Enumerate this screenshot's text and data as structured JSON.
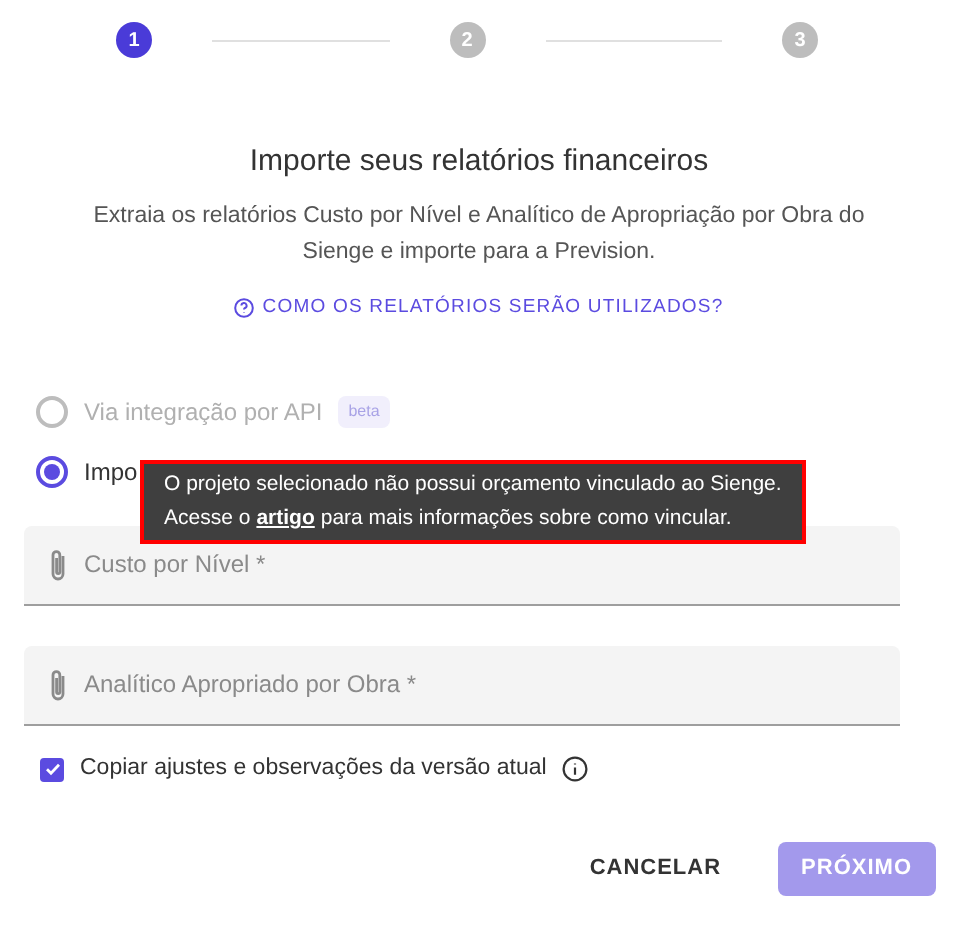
{
  "steps": [
    {
      "label": "1",
      "selected": true
    },
    {
      "label": "2",
      "selected": false
    },
    {
      "label": "3",
      "selected": false
    }
  ],
  "title": "Importe seus relatórios financeiros",
  "description": "Extraia os relatórios Custo por Nível e Analítico de Apropriação por Obra do Sienge e importe para a Prevision.",
  "help_link": "COMO OS RELATÓRIOS SERÃO UTILIZADOS?",
  "options": [
    {
      "label": "Via integração por API",
      "badge": "beta",
      "selected": false,
      "disabled": true
    },
    {
      "label": "Impo",
      "selected": true,
      "disabled": false
    }
  ],
  "tooltip": {
    "line_1": "O projeto selecionado não possui orçamento vinculado ao Sienge.",
    "before_link": "Acesse o",
    "link": "artigo",
    "after_link": "para mais informações sobre como vincular."
  },
  "fields": [
    {
      "placeholder": "Custo por Nível *"
    },
    {
      "placeholder": "Analítico Apropriado por Obra *"
    }
  ],
  "copy_option": {
    "label": "Copiar ajustes e observações da versão atual",
    "checked": true
  },
  "buttons": [
    {
      "label": "CANCELAR",
      "kind": "text",
      "disabled": false
    },
    {
      "label": "PRÓXIMO",
      "kind": "primary",
      "disabled": true
    }
  ]
}
